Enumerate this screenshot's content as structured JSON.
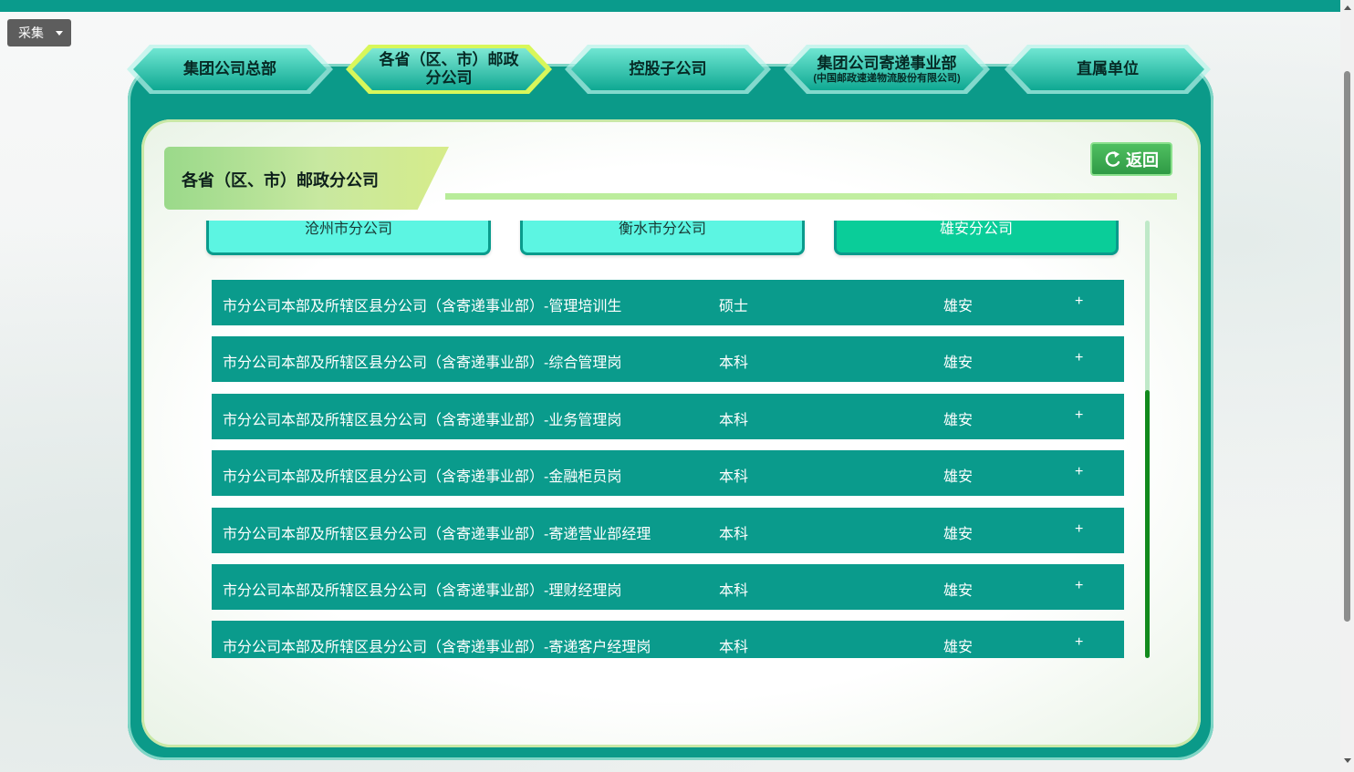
{
  "collect_button": {
    "label": "采集",
    "icon": "caret-down-icon"
  },
  "tabs": [
    {
      "label": "集团公司总部",
      "sub": "",
      "active": false
    },
    {
      "label": "各省（区、市）邮政分公司",
      "sub": "",
      "active": true
    },
    {
      "label": "控股子公司",
      "sub": "",
      "active": false
    },
    {
      "label": "集团公司寄递事业部",
      "sub": "(中国邮政速递物流股份有限公司)",
      "active": false
    },
    {
      "label": "直属单位",
      "sub": "",
      "active": false
    }
  ],
  "section": {
    "title": "各省（区、市）邮政分公司",
    "back_label": "返回",
    "back_icon": "return-arrow-icon"
  },
  "cities": [
    {
      "label": "沧州市分公司",
      "active": false
    },
    {
      "label": "衡水市分公司",
      "active": false
    },
    {
      "label": "雄安分公司",
      "active": true
    }
  ],
  "rows": [
    {
      "position": "市分公司本部及所辖区县分公司（含寄递事业部）-管理培训生",
      "degree": "硕士",
      "location": "雄安",
      "action": "+"
    },
    {
      "position": "市分公司本部及所辖区县分公司（含寄递事业部）-综合管理岗",
      "degree": "本科",
      "location": "雄安",
      "action": "+"
    },
    {
      "position": "市分公司本部及所辖区县分公司（含寄递事业部）-业务管理岗",
      "degree": "本科",
      "location": "雄安",
      "action": "+"
    },
    {
      "position": "市分公司本部及所辖区县分公司（含寄递事业部）-金融柜员岗",
      "degree": "本科",
      "location": "雄安",
      "action": "+"
    },
    {
      "position": "市分公司本部及所辖区县分公司（含寄递事业部）-寄递营业部经理",
      "degree": "本科",
      "location": "雄安",
      "action": "+"
    },
    {
      "position": "市分公司本部及所辖区县分公司（含寄递事业部）-理财经理岗",
      "degree": "本科",
      "location": "雄安",
      "action": "+"
    },
    {
      "position": "市分公司本部及所辖区县分公司（含寄递事业部）-寄递客户经理岗",
      "degree": "本科",
      "location": "雄安",
      "action": "+"
    }
  ],
  "colors": {
    "brand": "#0a9b8c",
    "active_city": "#0acd99",
    "city": "#5cf5e2",
    "active_tab": "#c8f04a",
    "scroll_thumb": "#118a1c"
  }
}
